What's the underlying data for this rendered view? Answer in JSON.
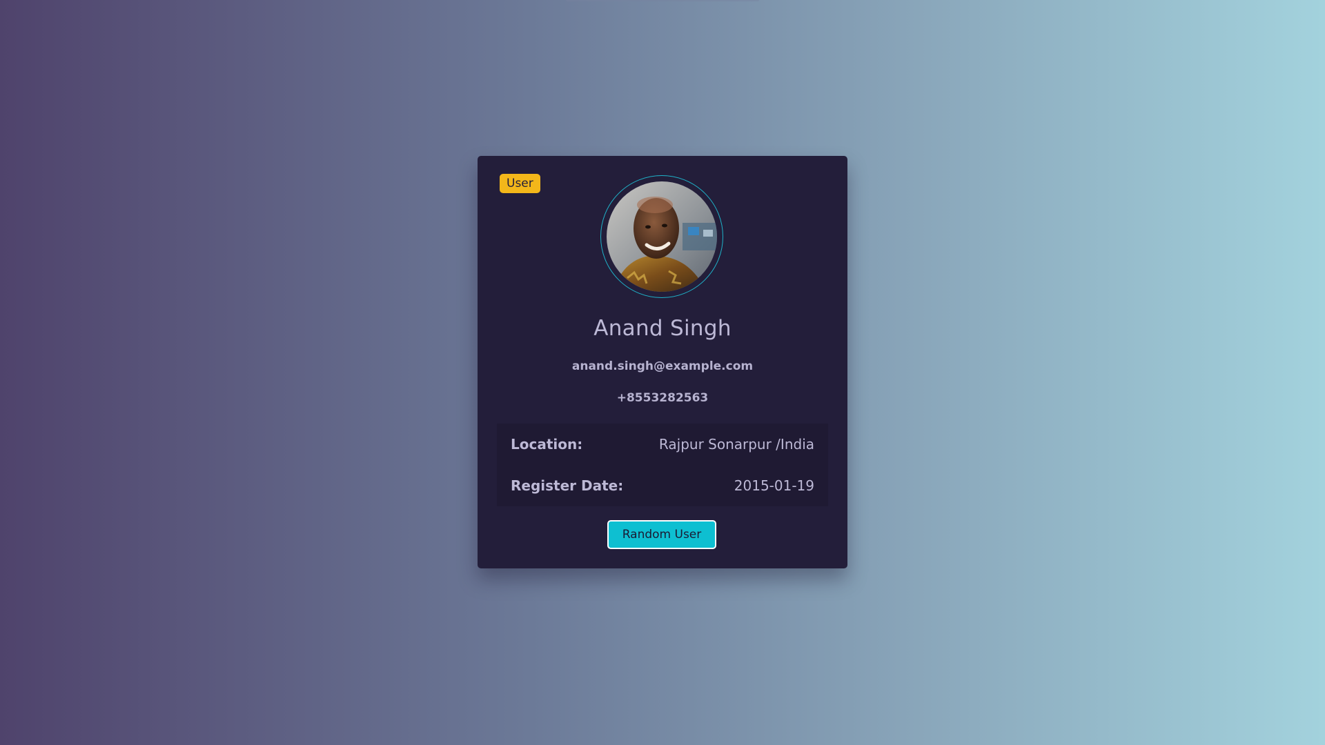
{
  "card": {
    "role_badge": "User",
    "name": "Anand Singh",
    "email": "anand.singh@example.com",
    "phone": "+8553282563",
    "info": {
      "location_label": "Location:",
      "location_value": "Rajpur Sonarpur /India",
      "register_label": "Register Date:",
      "register_value": "2015-01-19"
    },
    "button_label": "Random User"
  },
  "colors": {
    "card_bg": "#231e3a",
    "badge": "#f3b71a",
    "accent": "#0ebfd1",
    "ring": "#1fb3c9"
  }
}
